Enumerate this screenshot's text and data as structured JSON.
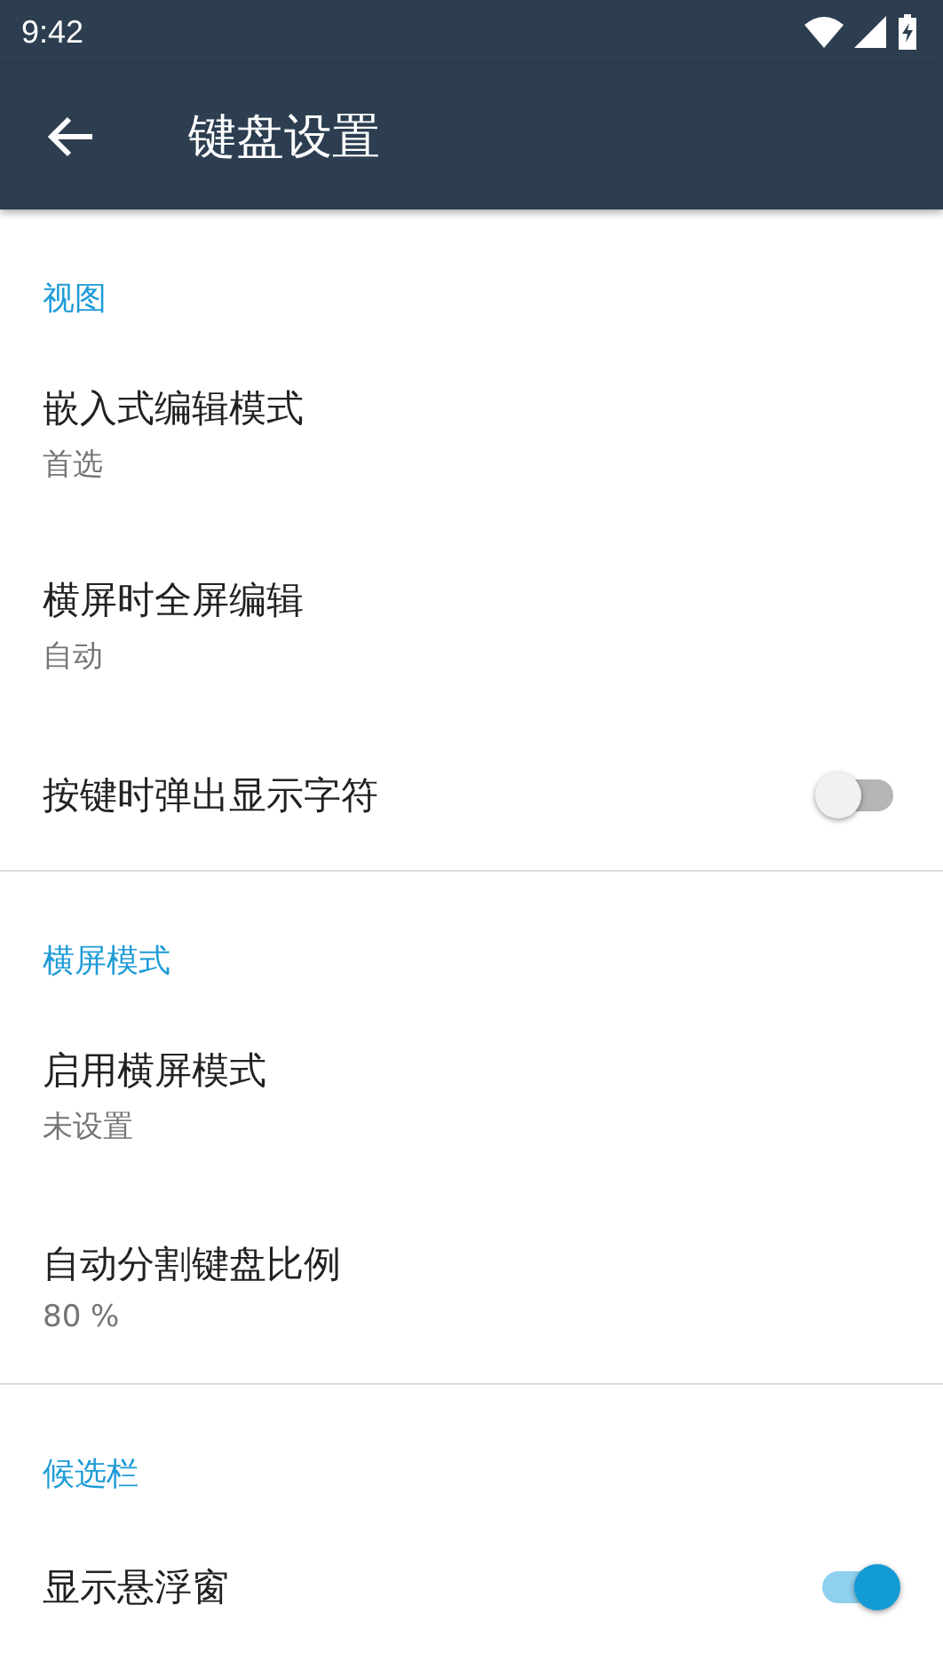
{
  "status_bar": {
    "time": "9:42"
  },
  "toolbar": {
    "title": "键盘设置"
  },
  "sections": [
    {
      "header": "视图",
      "items": [
        {
          "kind": "summary",
          "title": "嵌入式编辑模式",
          "summary": "首选"
        },
        {
          "kind": "summary",
          "title": "横屏时全屏编辑",
          "summary": "自动"
        },
        {
          "kind": "switch",
          "title": "按键时弹出显示字符",
          "on": false
        }
      ]
    },
    {
      "header": "横屏模式",
      "items": [
        {
          "kind": "summary",
          "title": "启用横屏模式",
          "summary": "未设置"
        },
        {
          "kind": "summary",
          "title": "自动分割键盘比例",
          "summary": "80 %"
        }
      ]
    },
    {
      "header": "候选栏",
      "items": [
        {
          "kind": "switch",
          "title": "显示悬浮窗",
          "on": true
        }
      ]
    }
  ]
}
